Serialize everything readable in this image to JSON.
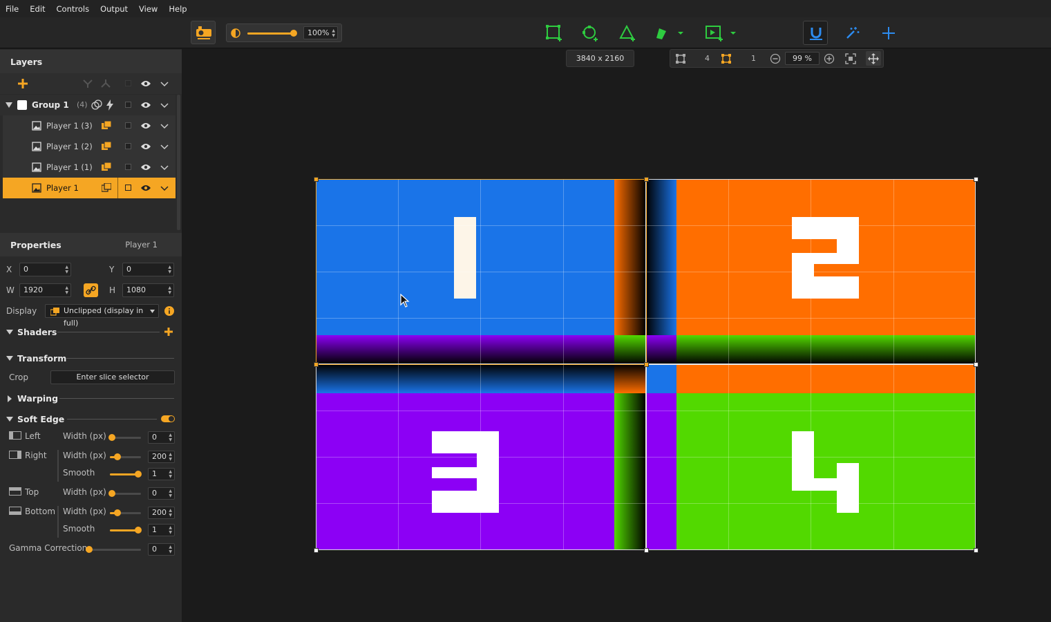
{
  "menu": [
    "File",
    "Edit",
    "Controls",
    "Output",
    "View",
    "Help"
  ],
  "toolbar": {
    "opacity_value": "100%",
    "resolution": "3840 x 2160",
    "count_a": "4",
    "count_b": "1",
    "zoom": "99 %",
    "accent": "#f5a623",
    "green": "#2ecc40",
    "blue": "#2d8cf0"
  },
  "layers": {
    "title": "Layers",
    "group": {
      "name": "Group 1",
      "count": "(4)"
    },
    "items": [
      {
        "name": "Player 1 (3)"
      },
      {
        "name": "Player 1 (2)"
      },
      {
        "name": "Player 1 (1)"
      },
      {
        "name": "Player 1",
        "selected": true
      }
    ]
  },
  "properties": {
    "title": "Properties",
    "subtitle": "Player 1",
    "x_label": "X",
    "x": "0",
    "y_label": "Y",
    "y": "0",
    "w_label": "W",
    "w": "1920",
    "h_label": "H",
    "h": "1080",
    "display_label": "Display",
    "display_value": "Unclipped (display in full)",
    "shaders": "Shaders",
    "transform": "Transform",
    "crop_label": "Crop",
    "crop_button": "Enter slice selector",
    "warping": "Warping",
    "soft_edge": "Soft Edge",
    "left": "Left",
    "right": "Right",
    "top": "Top",
    "bottom": "Bottom",
    "width_px": "Width (px)",
    "smooth": "Smooth",
    "left_width": "0",
    "right_width": "200",
    "right_smooth": "1",
    "top_width": "0",
    "bottom_width": "200",
    "bottom_smooth": "1",
    "gamma_label": "Gamma Correction",
    "gamma": "0"
  },
  "quadrants": [
    {
      "label": "1",
      "color": "#1a74e8"
    },
    {
      "label": "2",
      "color": "#ff6e00"
    },
    {
      "label": "3",
      "color": "#8c00f5"
    },
    {
      "label": "4",
      "color": "#52d900"
    }
  ]
}
